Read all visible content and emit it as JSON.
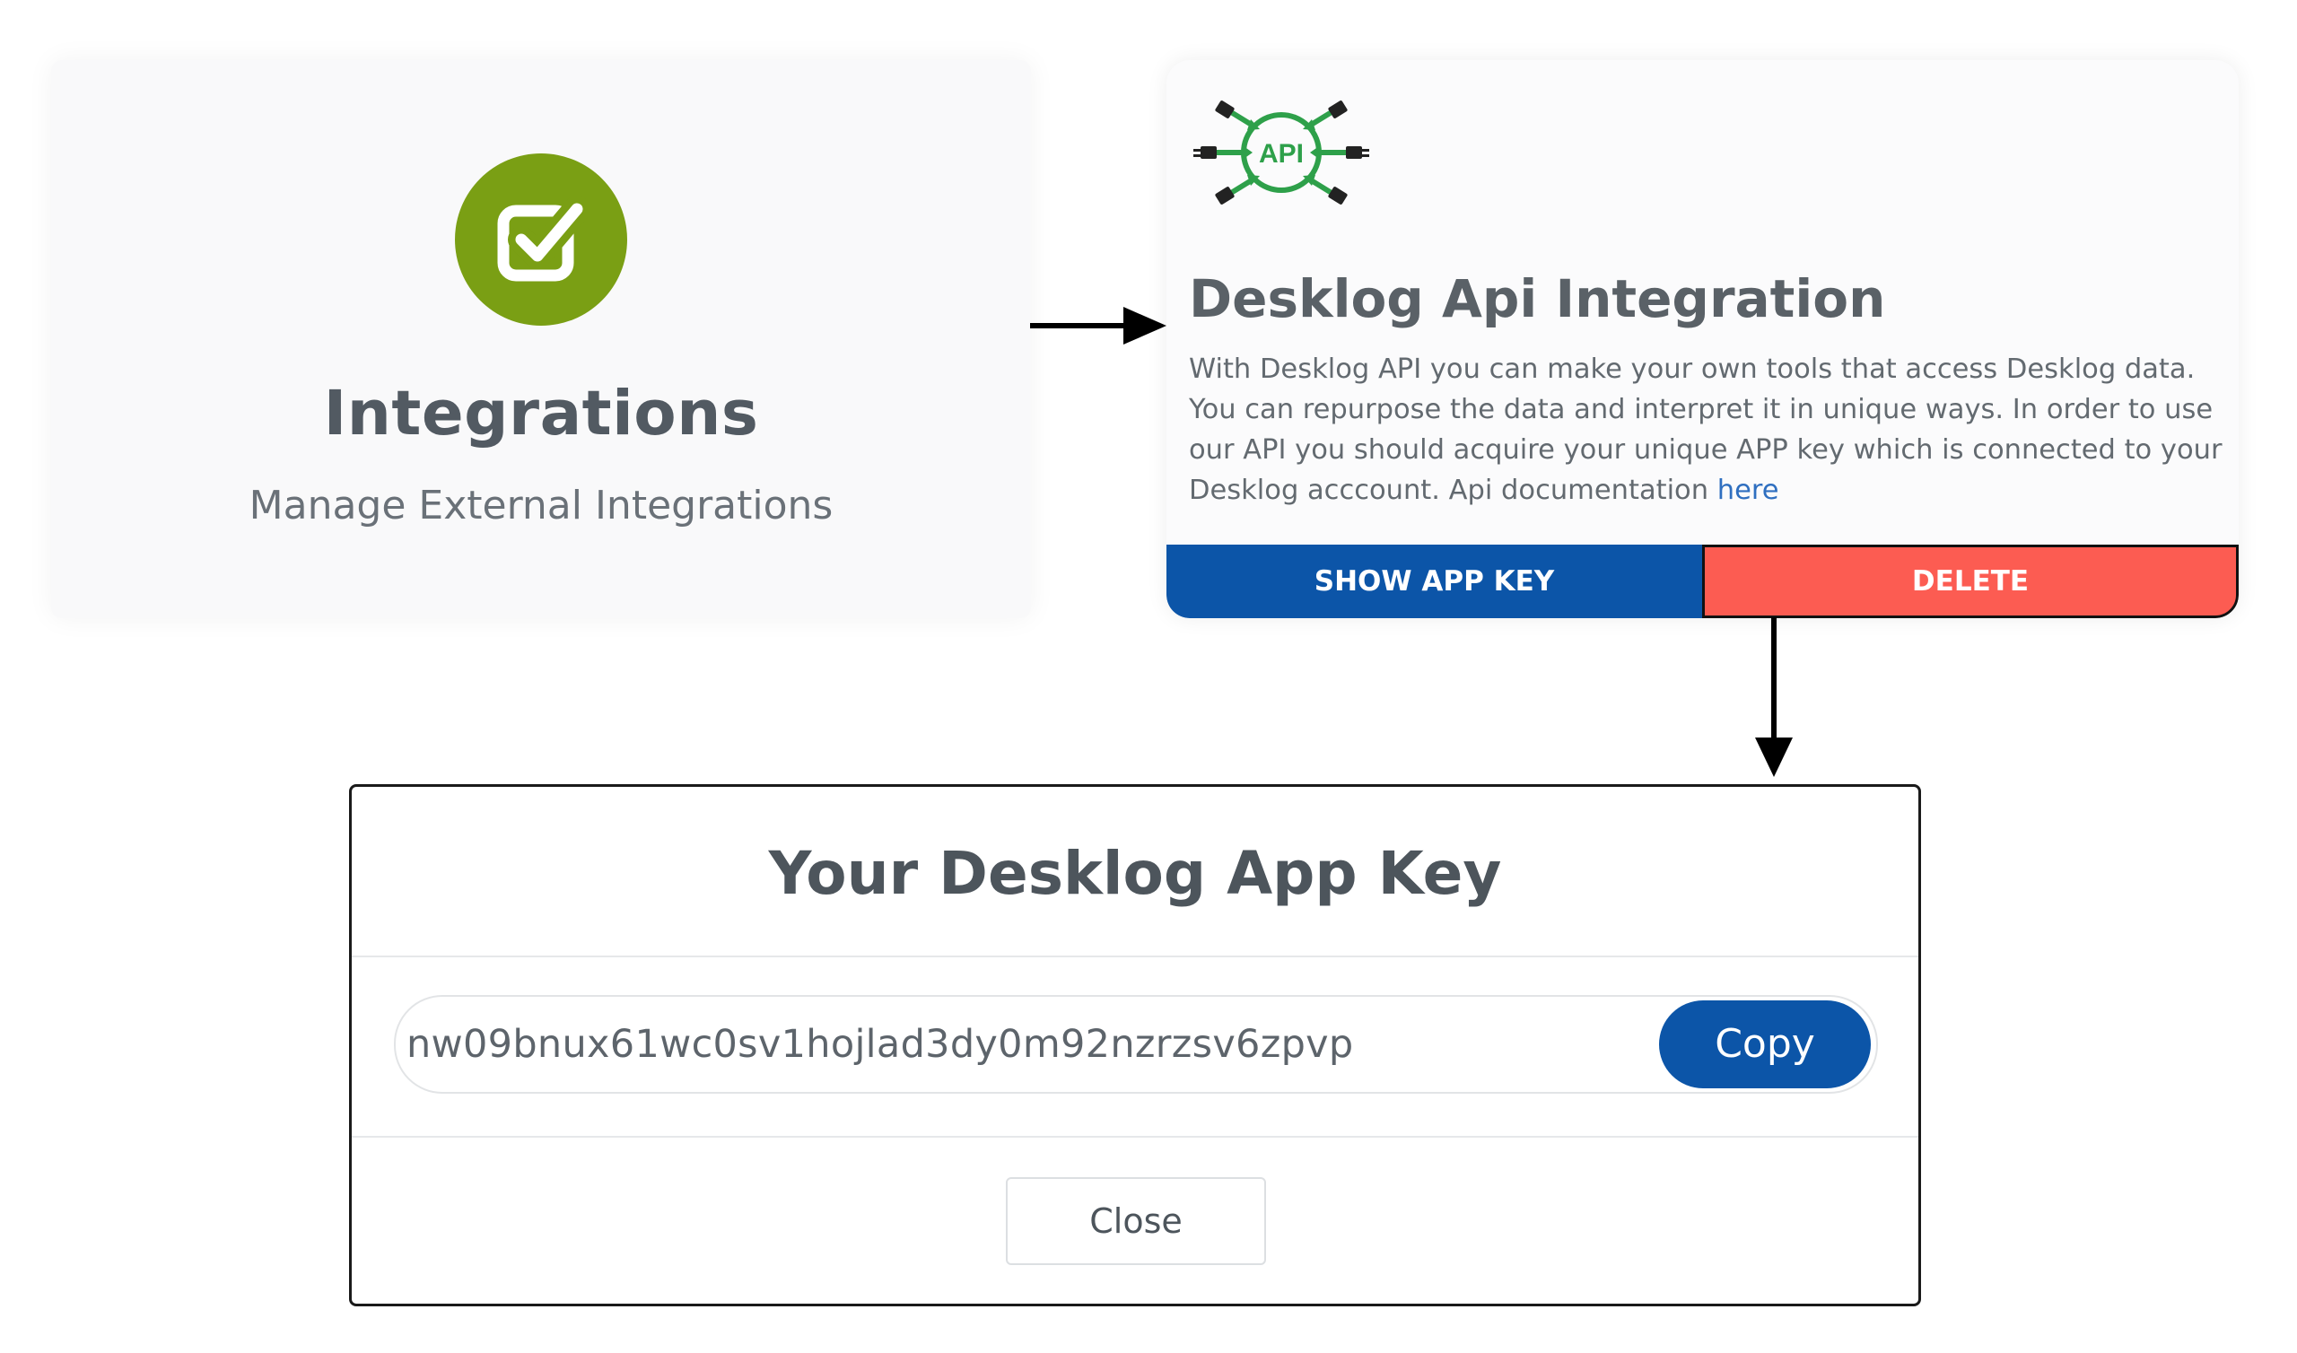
{
  "integrations_card": {
    "title": "Integrations",
    "subtitle": "Manage External Integrations",
    "icon": "check-square-icon",
    "icon_color": "#7a9f14"
  },
  "api_card": {
    "logo_text": "API",
    "logo_color": "#2ea04a",
    "title": "Desklog Api Integration",
    "description": "With Desklog API you can make your own tools that access Desklog data. You can repurpose the data and interpret it in unique ways. In order to use our API you should acquire your unique APP key which is connected to your Desklog acccount. Api documentation ",
    "doc_link_label": "here",
    "show_key_label": "SHOW APP KEY",
    "delete_label": "DELETE",
    "show_key_color": "#0c55a8",
    "delete_color": "#fc5c52"
  },
  "modal": {
    "title": "Your Desklog App Key",
    "app_key": "nw09bnux61wc0sv1hojlad3dy0m92nzrzsv6zpvp",
    "copy_label": "Copy",
    "close_label": "Close"
  }
}
